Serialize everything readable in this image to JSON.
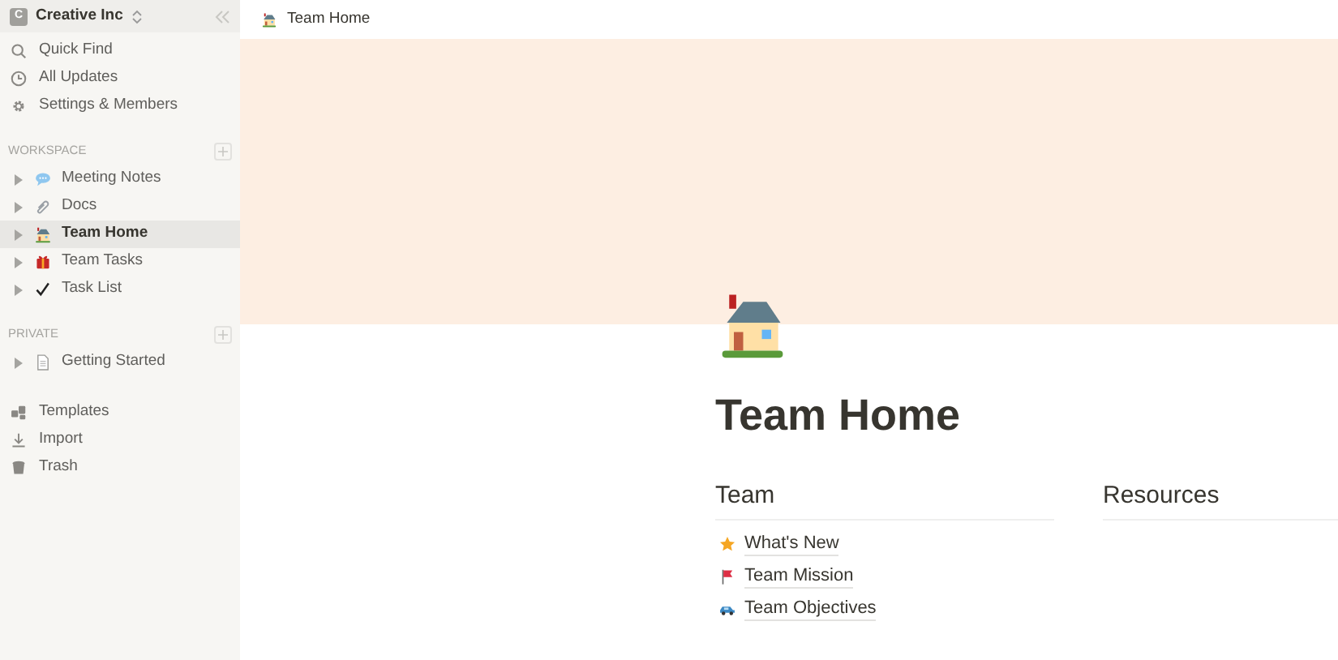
{
  "workspace": {
    "initial": "C",
    "name": "Creative Inc"
  },
  "nav": [
    {
      "kind": "search",
      "label": "Quick Find"
    },
    {
      "kind": "clock",
      "label": "All Updates"
    },
    {
      "kind": "gear",
      "label": "Settings & Members"
    }
  ],
  "sections": [
    {
      "title": "WORKSPACE",
      "pages": [
        {
          "kind": "speech",
          "label": "Meeting Notes",
          "selected": false
        },
        {
          "kind": "clip",
          "label": "Docs",
          "selected": false
        },
        {
          "kind": "house",
          "label": "Team Home",
          "selected": true
        },
        {
          "kind": "gift",
          "label": "Team Tasks",
          "selected": false
        },
        {
          "kind": "check",
          "label": "Task List",
          "selected": false
        }
      ]
    },
    {
      "title": "PRIVATE",
      "pages": [
        {
          "kind": "doc",
          "label": "Getting Started",
          "selected": false
        }
      ]
    }
  ],
  "footer": [
    {
      "kind": "templates",
      "label": "Templates"
    },
    {
      "kind": "import",
      "label": "Import"
    },
    {
      "kind": "trash",
      "label": "Trash"
    }
  ],
  "breadcrumb": {
    "kind": "house",
    "label": "Team Home"
  },
  "page": {
    "kind": "house",
    "title": "Team Home",
    "columns": [
      {
        "heading": "Team",
        "links": [
          {
            "kind": "star",
            "label": "What's New"
          },
          {
            "kind": "flag",
            "label": "Team Mission"
          },
          {
            "kind": "car",
            "label": "Team Objectives"
          }
        ]
      },
      {
        "heading": "Resources"
      }
    ]
  }
}
